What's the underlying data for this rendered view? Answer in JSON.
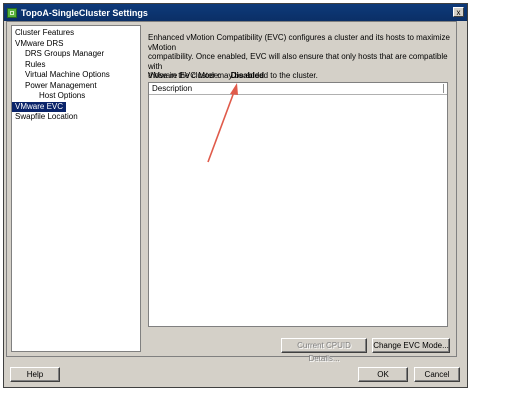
{
  "window": {
    "title": "TopoA-SingleCluster Settings",
    "close_glyph": "x"
  },
  "nav": {
    "items": [
      {
        "label": "Cluster Features"
      },
      {
        "label": "VMware DRS"
      },
      {
        "label": "DRS Groups Manager"
      },
      {
        "label": "Rules"
      },
      {
        "label": "Virtual Machine Options"
      },
      {
        "label": "Power Management"
      },
      {
        "label": "Host Options"
      },
      {
        "label": "VMware EVC",
        "selected": true
      },
      {
        "label": "Swapfile Location"
      }
    ]
  },
  "evc": {
    "description_lines": [
      "Enhanced vMotion Compatibility (EVC) configures a cluster and its hosts to maximize vMotion",
      "compatibility. Once enabled, EVC will also ensure that only hosts that are compatible with",
      "those in the cluster may be added to the cluster."
    ],
    "mode_label": "VMware EVC Mode:",
    "mode_value": "Disabled",
    "table_header": "Description",
    "current_cpuid_button": "Current CPUID Details...",
    "change_mode_button": "Change EVC Mode..."
  },
  "footer": {
    "help_button": "Help",
    "ok_button": "OK",
    "cancel_button": "Cancel"
  },
  "colors": {
    "title_bar": "#0e3a7a",
    "selection": "#0a246a",
    "annotation_arrow": "#e05a4a"
  },
  "icons": {
    "app": "cluster-icon",
    "close": "close-icon",
    "annotation": "arrow-icon"
  }
}
